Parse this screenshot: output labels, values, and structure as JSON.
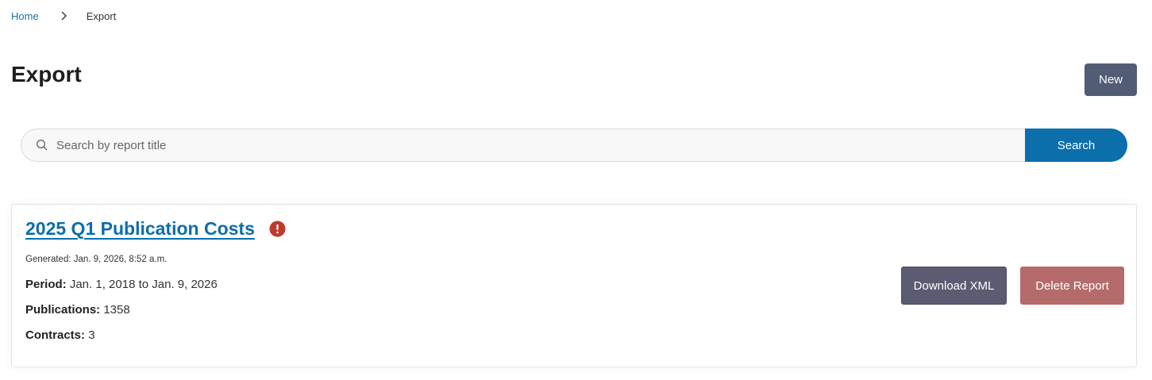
{
  "breadcrumb": {
    "home": "Home",
    "current": "Export"
  },
  "header": {
    "title": "Export",
    "new_label": "New"
  },
  "search": {
    "placeholder": "Search by report title",
    "value": "",
    "button_label": "Search"
  },
  "reports": [
    {
      "title": "2025 Q1 Publication Costs",
      "status_icon": "exclamation-alert-icon",
      "generated": "Generated: Jan. 9, 2026, 8:52 a.m.",
      "period_label": "Period:",
      "period_value": "Jan. 1, 2018 to Jan. 9, 2026",
      "publications_label": "Publications:",
      "publications_value": "1358",
      "contracts_label": "Contracts:",
      "contracts_value": "3",
      "download_label": "Download XML",
      "delete_label": "Delete Report"
    }
  ],
  "colors": {
    "link": "#0c6eab",
    "primary": "#0c6eab",
    "new_button": "#525c74",
    "download_button": "#5b5c72",
    "delete_button": "#b56b6b",
    "alert": "#c0392b"
  }
}
